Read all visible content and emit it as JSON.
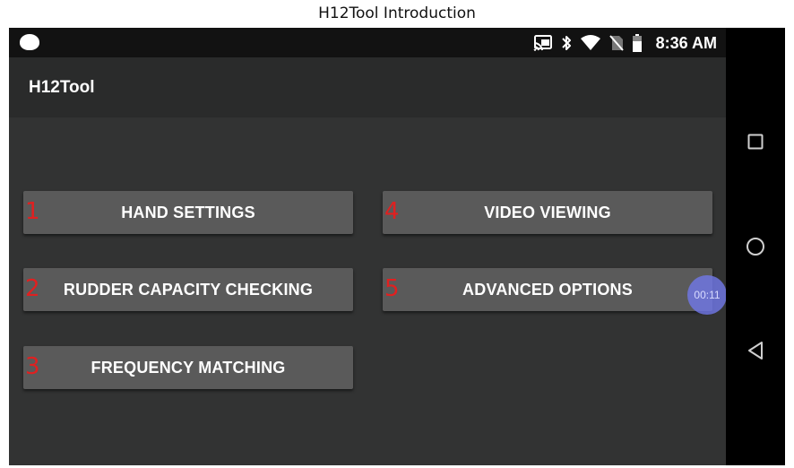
{
  "document": {
    "title": "H12Tool Introduction"
  },
  "status_bar": {
    "time": "8:36 AM",
    "icons": [
      "notification-icon",
      "cast-icon",
      "bluetooth-icon",
      "wifi-icon",
      "no-sim-icon",
      "battery-icon"
    ]
  },
  "app_bar": {
    "title": "H12Tool"
  },
  "menu": {
    "buttons": [
      {
        "number": "1",
        "label": "HAND SETTINGS"
      },
      {
        "number": "2",
        "label": "RUDDER CAPACITY CHECKING"
      },
      {
        "number": "3",
        "label": "FREQUENCY MATCHING"
      },
      {
        "number": "4",
        "label": "VIDEO VIEWING"
      },
      {
        "number": "5",
        "label": "ADVANCED OPTIONS"
      }
    ]
  },
  "overlay": {
    "timer": "00:11"
  },
  "nav_bar": {
    "icons": [
      "recents-icon",
      "home-icon",
      "back-icon"
    ]
  },
  "colors": {
    "content_bg": "#323333",
    "button_bg": "#5a5a5a",
    "number_annotation": "#e02020",
    "timer_bubble": "#7078e6"
  }
}
